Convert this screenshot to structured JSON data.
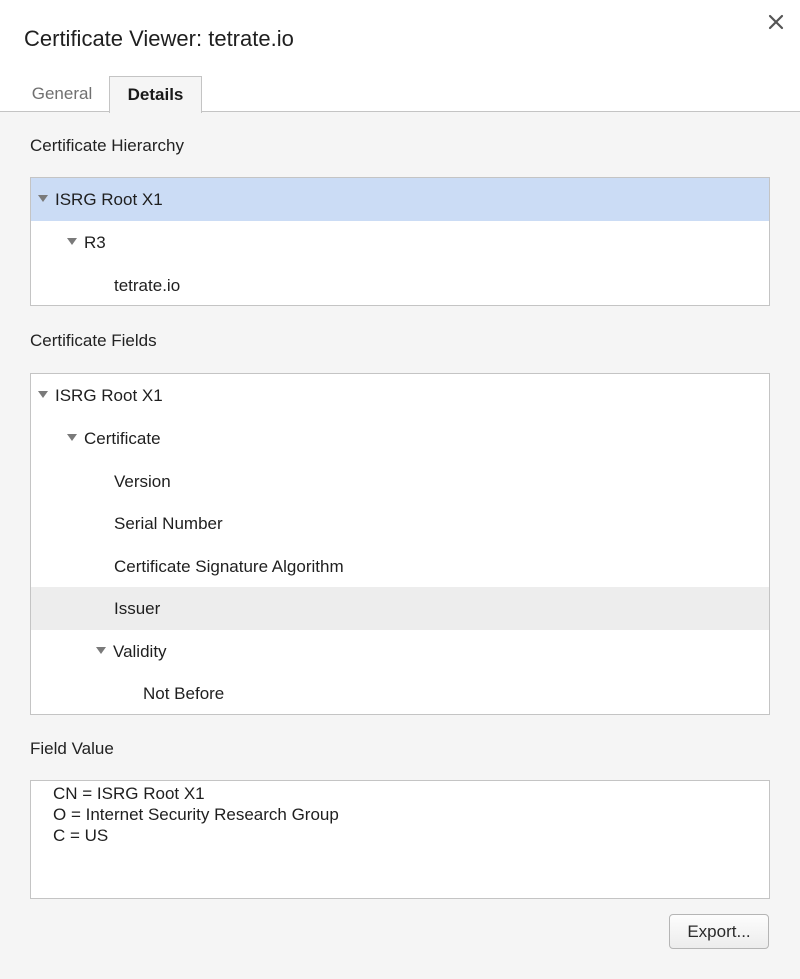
{
  "window": {
    "title": "Certificate Viewer: tetrate.io",
    "close_icon": "close-icon"
  },
  "tabs": [
    {
      "label": "General",
      "active": false
    },
    {
      "label": "Details",
      "active": true
    }
  ],
  "hierarchy": {
    "label": "Certificate Hierarchy",
    "items": [
      {
        "label": "ISRG Root X1",
        "expanded": true,
        "selected": true
      },
      {
        "label": "R3",
        "expanded": true,
        "selected": false
      },
      {
        "label": "tetrate.io",
        "expanded": false,
        "selected": false
      }
    ]
  },
  "fields": {
    "label": "Certificate Fields",
    "items": [
      {
        "label": "ISRG Root X1",
        "expanded": true
      },
      {
        "label": "Certificate",
        "expanded": true
      },
      {
        "label": "Version"
      },
      {
        "label": "Serial Number"
      },
      {
        "label": "Certificate Signature Algorithm"
      },
      {
        "label": "Issuer",
        "highlighted": true
      },
      {
        "label": "Validity",
        "expanded": true
      },
      {
        "label": "Not Before"
      }
    ]
  },
  "field_value": {
    "label": "Field Value",
    "lines": [
      "CN = ISRG Root X1",
      "O = Internet Security Research Group",
      "C = US"
    ]
  },
  "buttons": {
    "export_label": "Export..."
  },
  "colors": {
    "selection": "#cbdcf5",
    "hover_row": "#ededed",
    "dialog_bg": "#f5f5f5",
    "border": "#c4c4c4"
  }
}
